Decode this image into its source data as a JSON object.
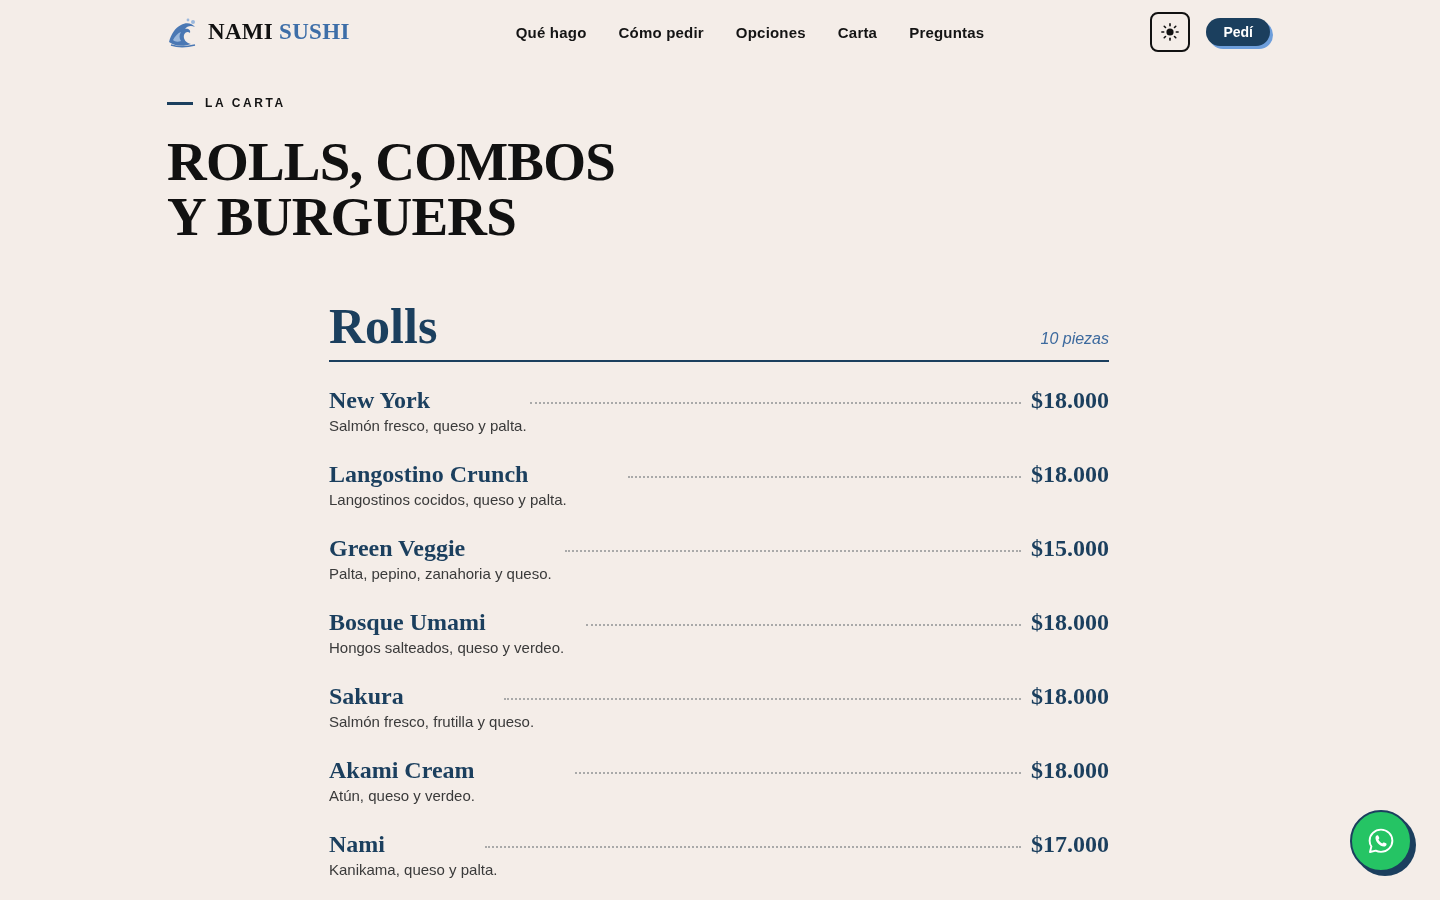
{
  "header": {
    "brand": {
      "primary": "NAMI",
      "accent": "SUSHI"
    },
    "nav": [
      {
        "label": "Qué hago"
      },
      {
        "label": "Cómo pedir"
      },
      {
        "label": "Opciones"
      },
      {
        "label": "Carta"
      },
      {
        "label": "Preguntas"
      }
    ],
    "order_button": "Pedí"
  },
  "section": {
    "eyebrow": "LA CARTA",
    "title_lines": [
      "ROLLS, COMBOS",
      "Y BURGUERS"
    ]
  },
  "menu": {
    "title": "Rolls",
    "note": "10 piezas",
    "items": [
      {
        "name": "New York",
        "description": "Salmón fresco, queso y palta.",
        "price": "$18.000"
      },
      {
        "name": "Langostino Crunch",
        "description": "Langostinos cocidos, queso y palta.",
        "price": "$18.000"
      },
      {
        "name": "Green Veggie",
        "description": "Palta, pepino, zanahoria y queso.",
        "price": "$15.000"
      },
      {
        "name": "Bosque Umami",
        "description": "Hongos salteados, queso y verdeo.",
        "price": "$18.000"
      },
      {
        "name": "Sakura",
        "description": "Salmón fresco, frutilla y queso.",
        "price": "$18.000"
      },
      {
        "name": "Akami Cream",
        "description": "Atún, queso y verdeo.",
        "price": "$18.000"
      },
      {
        "name": "Nami",
        "description": "Kanikama, queso y palta.",
        "price": "$17.000"
      }
    ]
  }
}
